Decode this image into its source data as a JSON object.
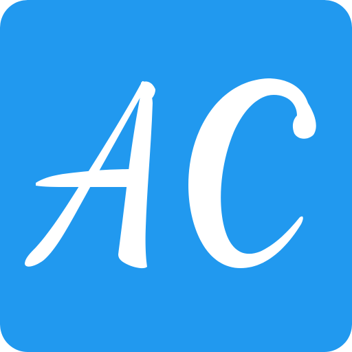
{
  "icon": {
    "monogram": "AC",
    "background_color": "#2199EF",
    "letter_color": "#FFFFFF"
  }
}
